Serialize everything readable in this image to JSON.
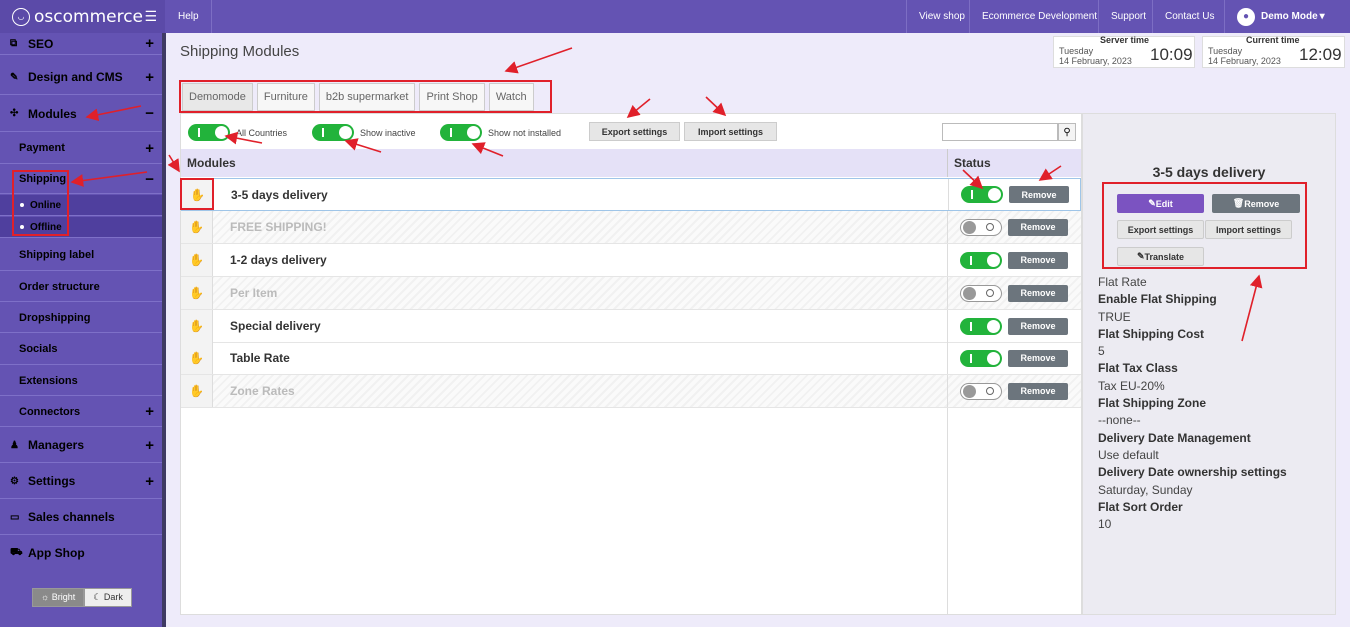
{
  "topbar": {
    "logo": "oscommerce",
    "help": "Help",
    "nav": [
      "View shop",
      "Ecommerce Development",
      "Support",
      "Contact Us"
    ],
    "user": "Demo Mode"
  },
  "sidebar": {
    "items": [
      {
        "label": "SEO",
        "icon": "sitemap-icon",
        "expand": "+"
      },
      {
        "label": "Design and CMS",
        "icon": "brush-icon",
        "expand": "+"
      },
      {
        "label": "Modules",
        "icon": "puzzle-icon",
        "expand": "−"
      },
      {
        "label": "Payment",
        "expand": "+"
      },
      {
        "label": "Shipping",
        "expand": "−"
      },
      {
        "label": "Online"
      },
      {
        "label": "Offline"
      },
      {
        "label": "Shipping label"
      },
      {
        "label": "Order structure"
      },
      {
        "label": "Dropshipping"
      },
      {
        "label": "Socials"
      },
      {
        "label": "Extensions"
      },
      {
        "label": "Connectors",
        "expand": "+"
      },
      {
        "label": "Managers",
        "icon": "user-icon",
        "expand": "+"
      },
      {
        "label": "Settings",
        "icon": "gears-icon",
        "expand": "+"
      },
      {
        "label": "Sales channels",
        "icon": "monitor-icon"
      },
      {
        "label": "App Shop",
        "icon": "cart-icon"
      }
    ],
    "theme": {
      "bright": "Bright",
      "dark": "Dark"
    }
  },
  "page": {
    "title": "Shipping Modules",
    "server_time": {
      "label": "Server time",
      "day": "Tuesday",
      "date": "14 February, 2023",
      "time": "10:09"
    },
    "current_time": {
      "label": "Current time",
      "day": "Tuesday",
      "date": "14 February, 2023",
      "time": "12:09"
    }
  },
  "tabs": [
    "Demomode",
    "Furniture",
    "b2b supermarket",
    "Print Shop",
    "Watch"
  ],
  "filters": {
    "all_countries": "All Countries",
    "show_inactive": "Show inactive",
    "show_not_installed": "Show not installed",
    "export": "Export settings",
    "import": "Import settings",
    "search_placeholder": ""
  },
  "table": {
    "col_modules": "Modules",
    "col_status": "Status",
    "remove_label": "Remove",
    "rows": [
      {
        "name": "3-5 days delivery",
        "active": true
      },
      {
        "name": "FREE SHIPPING!",
        "active": false
      },
      {
        "name": "1-2 days delivery",
        "active": true
      },
      {
        "name": "Per Item",
        "active": false
      },
      {
        "name": "Special delivery",
        "active": true
      },
      {
        "name": "Table Rate",
        "active": true
      },
      {
        "name": "Zone Rates",
        "active": false
      }
    ]
  },
  "detail": {
    "title": "3-5 days delivery",
    "edit": "Edit",
    "remove": "Remove",
    "export": "Export settings",
    "import": "Import settings",
    "translate": "Translate",
    "type": "Flat Rate",
    "props": [
      {
        "k": "Enable Flat Shipping",
        "v": "TRUE"
      },
      {
        "k": "Flat Shipping Cost",
        "v": "5"
      },
      {
        "k": "Flat Tax Class",
        "v": "Tax EU-20%"
      },
      {
        "k": "Flat Shipping Zone",
        "v": "--none--"
      },
      {
        "k": "Delivery Date Management",
        "v": "Use default"
      },
      {
        "k": "Delivery Date ownership settings",
        "v": "Saturday, Sunday"
      },
      {
        "k": "Flat Sort Order",
        "v": "10"
      }
    ]
  }
}
